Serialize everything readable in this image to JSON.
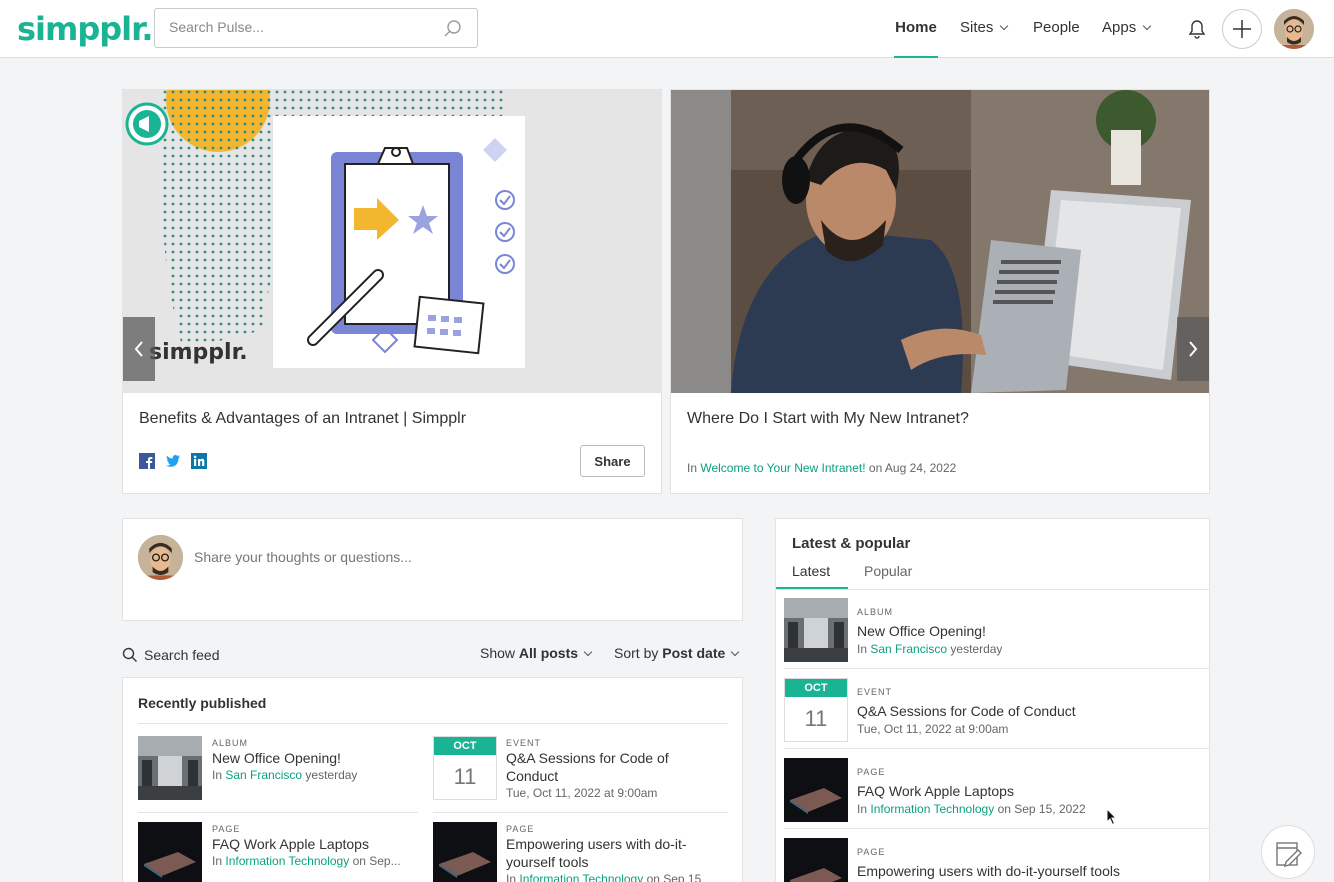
{
  "app": {
    "logo": "simpplr."
  },
  "header": {
    "search_placeholder": "Search Pulse...",
    "nav": {
      "home": "Home",
      "sites": "Sites",
      "people": "People",
      "apps": "Apps"
    }
  },
  "hero": [
    {
      "title": "Benefits & Advantages of an Intranet | Simpplr",
      "share_label": "Share",
      "brand_mark": "simpplr."
    },
    {
      "title": "Where Do I Start with My New Intranet?",
      "meta_prefix": "In",
      "meta_link": "Welcome to Your New Intranet!",
      "meta_suffix": "on Aug 24, 2022"
    }
  ],
  "composer": {
    "placeholder": "Share your thoughts or questions..."
  },
  "feed_toolbar": {
    "search_label": "Search feed",
    "show_prefix": "Show",
    "show_value": "All posts",
    "sort_prefix": "Sort by",
    "sort_value": "Post date"
  },
  "recently_published": {
    "title": "Recently published",
    "items": [
      {
        "type": "ALBUM",
        "title": "New Office Opening!",
        "in": "In",
        "link": "San Francisco",
        "suffix": "yesterday"
      },
      {
        "type": "EVENT",
        "month": "OCT",
        "day": "11",
        "title_line1": "Q&A Sessions for Code of",
        "title_line2": "Conduct",
        "meta": "Tue, Oct 11, 2022 at 9:00am"
      },
      {
        "type": "PAGE",
        "title": "FAQ Work Apple Laptops",
        "in": "In",
        "link": "Information Technology",
        "suffix": "on Sep..."
      },
      {
        "type": "PAGE",
        "title_line1": "Empowering users with do-it-",
        "title_line2": "yourself tools",
        "in": "In",
        "link": "Information Technology",
        "suffix": "on Sep 15"
      }
    ]
  },
  "latest_popular": {
    "title": "Latest & popular",
    "tabs": [
      "Latest",
      "Popular"
    ],
    "items": [
      {
        "type": "ALBUM",
        "title": "New Office Opening!",
        "in": "In",
        "link": "San Francisco",
        "suffix": "yesterday"
      },
      {
        "type": "EVENT",
        "month": "OCT",
        "day": "11",
        "title": "Q&A Sessions for Code of Conduct",
        "meta": "Tue, Oct 11, 2022 at 9:00am"
      },
      {
        "type": "PAGE",
        "title": "FAQ Work Apple Laptops",
        "in": "In",
        "link": "Information Technology",
        "suffix": "on Sep 15, 2022"
      },
      {
        "type": "PAGE",
        "title": "Empowering users with do-it-yourself tools"
      }
    ]
  },
  "icons": {
    "search": "search-icon",
    "bell": "bell-icon",
    "plus": "plus-icon",
    "facebook": "facebook-icon",
    "twitter": "twitter-icon",
    "linkedin": "linkedin-icon",
    "prev": "chevron-left-icon",
    "next": "chevron-right-icon",
    "feedback": "feedback-icon"
  },
  "colors": {
    "brand": "#1ab393",
    "link": "#13a688"
  }
}
